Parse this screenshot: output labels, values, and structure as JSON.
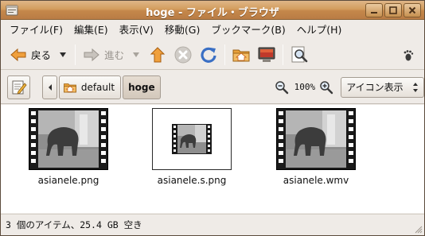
{
  "window": {
    "title": "hoge - ファイル・ブラウザ",
    "icons": [
      "file-manager-icon",
      "minimize-icon",
      "maximize-icon",
      "close-icon"
    ]
  },
  "menu": {
    "items": [
      "ファイル(F)",
      "編集(E)",
      "表示(V)",
      "移動(G)",
      "ブックマーク(B)",
      "ヘルプ(H)"
    ]
  },
  "toolbar": {
    "back_label": "戻る",
    "forward_label": "進む",
    "icons": [
      "back-arrow-icon",
      "dropdown-arrow-icon",
      "forward-arrow-icon",
      "up-arrow-icon",
      "stop-icon",
      "reload-icon",
      "home-folder-icon",
      "computer-icon",
      "search-icon",
      "gnome-foot-icon"
    ]
  },
  "location": {
    "breadcrumbs": [
      "default",
      "hoge"
    ],
    "zoom": "100%",
    "view_mode": "アイコン表示",
    "icons": [
      "edit-location-icon",
      "chevron-left-icon",
      "home-folder-icon",
      "zoom-out-icon",
      "zoom-in-icon",
      "spinner-arrows-icon"
    ]
  },
  "files": [
    {
      "name": "asianele.png",
      "type": "image"
    },
    {
      "name": "asianele.s.png",
      "type": "image"
    },
    {
      "name": "asianele.wmv",
      "type": "video"
    }
  ],
  "status": {
    "text": "3 個のアイテム、25.4 GB 空き"
  },
  "colors": {
    "titlebar": "#c98f52",
    "window_bg": "#efebe7",
    "accent_orange": "#f28a22",
    "accent_blue": "#3a6fc4"
  }
}
